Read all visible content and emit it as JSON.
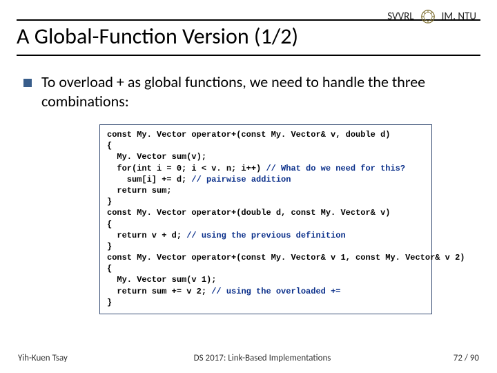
{
  "header": {
    "org_left": "SVVRL",
    "at": "@",
    "org_right": "IM. NTU"
  },
  "title": "A Global-Function Version (1/2)",
  "bullet": "To overload + as global functions, we need to handle the three combinations:",
  "code": {
    "l01": "const My. Vector operator+(const My. Vector& v, double d)",
    "l02": "{",
    "l03": "  My. Vector sum(v);",
    "l04a": "  for(int i = 0; i < v. n; i++) ",
    "l04b": "// What do we need for this?",
    "l05a": "    sum[i] += d; ",
    "l05b": "// pairwise addition",
    "l06": "  return sum;",
    "l07": "}",
    "l08": "const My. Vector operator+(double d, const My. Vector& v)",
    "l09": "{",
    "l10a": "  return v + d; ",
    "l10b": "// using the previous definition",
    "l11": "}",
    "l12": "const My. Vector operator+(const My. Vector& v 1, const My. Vector& v 2)",
    "l13": "{",
    "l14": "  My. Vector sum(v 1);",
    "l15a": "  return sum += v 2; ",
    "l15b": "// using the overloaded +=",
    "l16": "}"
  },
  "footer": {
    "author": "Yih-Kuen Tsay",
    "course": "DS 2017: Link-Based Implementations",
    "page": "72 / 90"
  }
}
